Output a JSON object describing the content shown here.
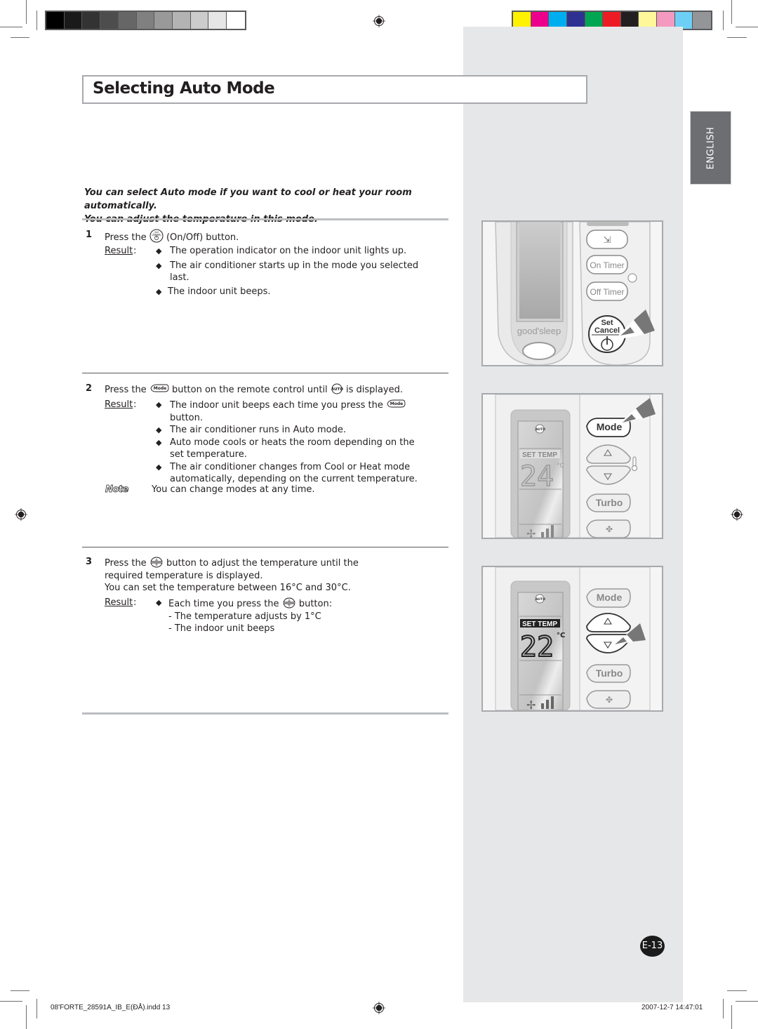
{
  "print_marks": {
    "grayscale_swatches": [
      "#000000",
      "#1a1a1a",
      "#333333",
      "#4d4d4d",
      "#666666",
      "#808080",
      "#999999",
      "#b3b3b3",
      "#cccccc",
      "#e6e6e6",
      "#ffffff"
    ],
    "color_swatches": [
      "#fff200",
      "#ec008c",
      "#00aeef",
      "#2e3192",
      "#00a651",
      "#ed1c24",
      "#231f20",
      "#fff799",
      "#f49ac1",
      "#6dcff6",
      "#939598"
    ]
  },
  "header": {
    "title": "Selecting Auto Mode",
    "language_tab": "ENGLISH"
  },
  "intro": {
    "line1": "You can select Auto mode if you want to cool or heat your room automatically.",
    "line2": "You can adjust the temperature in this mode."
  },
  "steps": [
    {
      "number": "1",
      "text_before": "Press the",
      "icon": "set-cancel-power-icon",
      "text_after": "(On/Off) button.",
      "result_label": "Result",
      "results": [
        "The operation indicator on the indoor unit lights up.",
        "The air conditioner starts up in the mode you selected last.",
        "The indoor unit beeps."
      ]
    },
    {
      "number": "2",
      "text_before": "Press the",
      "icon": "mode-button-icon",
      "text_middle": "button on the remote control until",
      "icon2": "auto-mode-icon",
      "text_after": "is displayed.",
      "result_label": "Result",
      "results": [
        {
          "before": "The indoor unit beeps each time you press the",
          "icon": "mode-button-icon",
          "after": "button."
        },
        "The air conditioner runs in Auto mode.",
        "Auto mode cools or heats the room depending on the set temperature.",
        "The air conditioner changes from Cool or Heat mode automatically, depending on the current temperature."
      ],
      "note_label": "Note",
      "note": "You can change modes at any time."
    },
    {
      "number": "3",
      "text_before": "Press the",
      "icon": "temperature-up-down-icon",
      "text_after": "button to adjust the temperature until the required temperature is displayed.",
      "range_text": "You can set the temperature between 16°C and 30°C.",
      "result_label": "Result",
      "results": [
        {
          "before": "Each time you press the",
          "icon": "temperature-up-down-icon",
          "after": "button:"
        }
      ],
      "sub_results": [
        "- The temperature adjusts by 1°C",
        "- The indoor unit beeps"
      ]
    }
  ],
  "remote_panels": [
    {
      "brand": "good'sleep",
      "buttons": [
        "swing",
        "On Timer",
        "Off Timer",
        "Set Cancel"
      ],
      "power_label_1": "Set",
      "power_label_2": "Cancel",
      "highlighted": "Set Cancel"
    },
    {
      "display_mode": "AUTO",
      "set_temp_label": "SET  TEMP",
      "temperature": "24",
      "unit": "°C",
      "buttons": [
        "Mode",
        "up",
        "down",
        "Turbo",
        "fan"
      ],
      "highlighted": "Mode"
    },
    {
      "display_mode": "AUTO",
      "set_temp_label": "SET  TEMP",
      "temperature": "22",
      "unit": "°C",
      "buttons": [
        "Mode",
        "up",
        "down",
        "Turbo",
        "fan"
      ],
      "highlighted": "down"
    }
  ],
  "page_number": "E-13",
  "footer": {
    "file": "08'FORTE_28591A_IB_E(ÐÅ).indd   13",
    "timestamp": "2007-12-7   14:47:01"
  }
}
